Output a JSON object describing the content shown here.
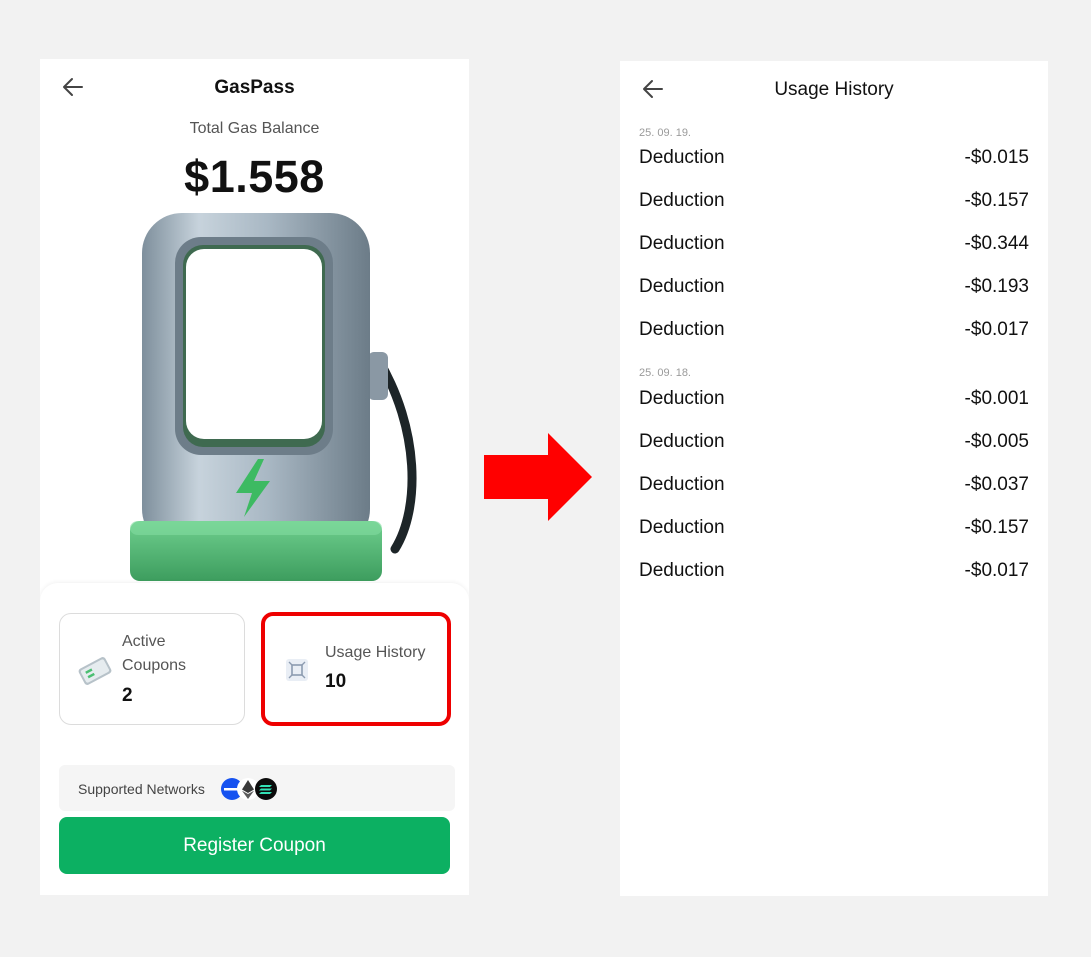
{
  "left": {
    "title": "GasPass",
    "balance_label": "Total Gas Balance",
    "balance": "$1.558",
    "cards": {
      "active_coupons": {
        "label_line1": "Active",
        "label_line2": "Coupons",
        "count": "2"
      },
      "usage_history": {
        "label": "Usage History",
        "count": "10"
      }
    },
    "networks": {
      "label": "Supported Networks",
      "icons": [
        "network-icon-1",
        "ethereum-icon",
        "solana-icon"
      ]
    },
    "register_button": "Register Coupon"
  },
  "right": {
    "title": "Usage History",
    "groups": [
      {
        "date": "25. 09. 19.",
        "items": [
          {
            "label": "Deduction",
            "amount": "-$0.015"
          },
          {
            "label": "Deduction",
            "amount": "-$0.157"
          },
          {
            "label": "Deduction",
            "amount": "-$0.344"
          },
          {
            "label": "Deduction",
            "amount": "-$0.193"
          },
          {
            "label": "Deduction",
            "amount": "-$0.017"
          }
        ]
      },
      {
        "date": "25. 09. 18.",
        "items": [
          {
            "label": "Deduction",
            "amount": "-$0.001"
          },
          {
            "label": "Deduction",
            "amount": "-$0.005"
          },
          {
            "label": "Deduction",
            "amount": "-$0.037"
          },
          {
            "label": "Deduction",
            "amount": "-$0.157"
          },
          {
            "label": "Deduction",
            "amount": "-$0.017"
          }
        ]
      }
    ]
  },
  "colors": {
    "accent_green": "#0cb062",
    "highlight_red": "#ee0000",
    "arrow_red": "#ff0000"
  }
}
